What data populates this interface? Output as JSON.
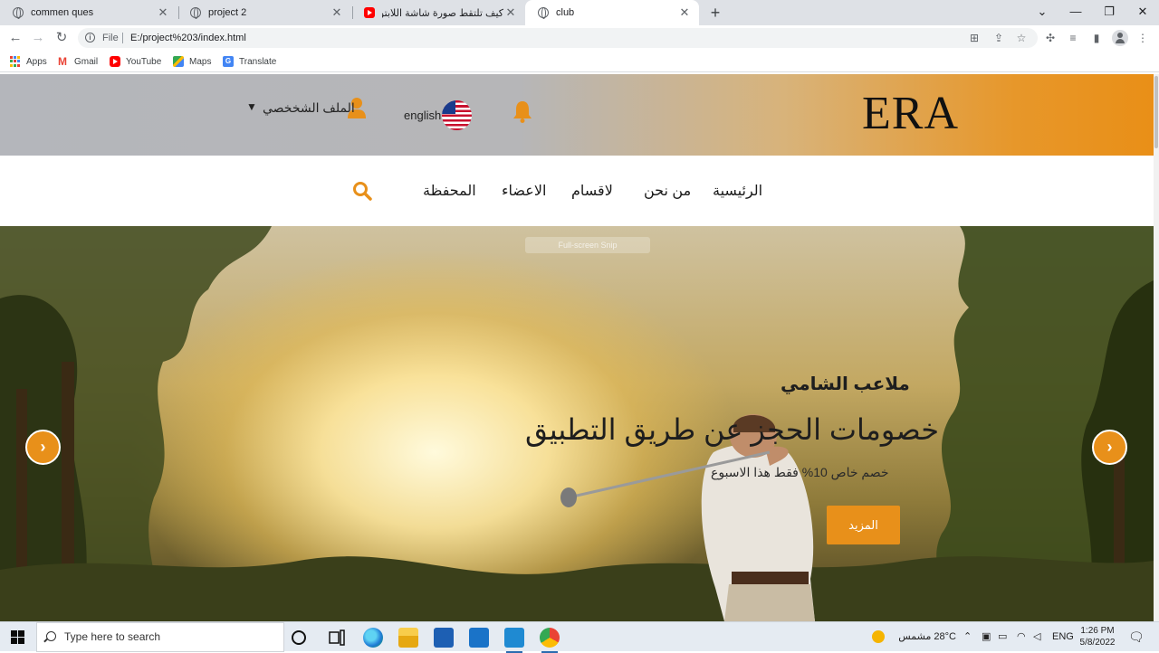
{
  "browser": {
    "tabs": [
      {
        "title": "commen ques",
        "icon": "globe-icon"
      },
      {
        "title": "project 2",
        "icon": "globe-icon"
      },
      {
        "title": "كيف تلتقط صورة شاشة اللابتوب او",
        "icon": "youtube-icon"
      },
      {
        "title": "club",
        "icon": "globe-icon",
        "active": true
      }
    ],
    "new_tab": "+",
    "window_controls": {
      "chevron": "⌄",
      "minimize": "—",
      "restore": "❐",
      "close": "✕"
    },
    "address": {
      "scheme": "File",
      "url": "E:/project%203/index.html"
    },
    "bookmarks": [
      "Apps",
      "Gmail",
      "YouTube",
      "Maps",
      "Translate"
    ]
  },
  "site": {
    "logo": "ERA",
    "language": "english",
    "profile": "الملف الشخخصي",
    "nav": [
      "الرئيسية",
      "من نحن",
      "لاقسام",
      "الاعضاء",
      "المحفظة"
    ],
    "hero": {
      "tooltip": "Full-screen Snip",
      "subtitle": "ملاعب الشامي",
      "title": "خصومات الحجز عن طريق التطبيق",
      "description": "خصم خاص 10% فقط هذا الاسبوع",
      "button": "المزيد",
      "prev": "‹",
      "next": "›"
    },
    "colors": {
      "accent": "#e8901a"
    }
  },
  "taskbar": {
    "search_placeholder": "Type here to search",
    "weather": "28°C  مشمس",
    "lang": "ENG",
    "time": "1:26 PM",
    "date": "5/8/2022"
  }
}
